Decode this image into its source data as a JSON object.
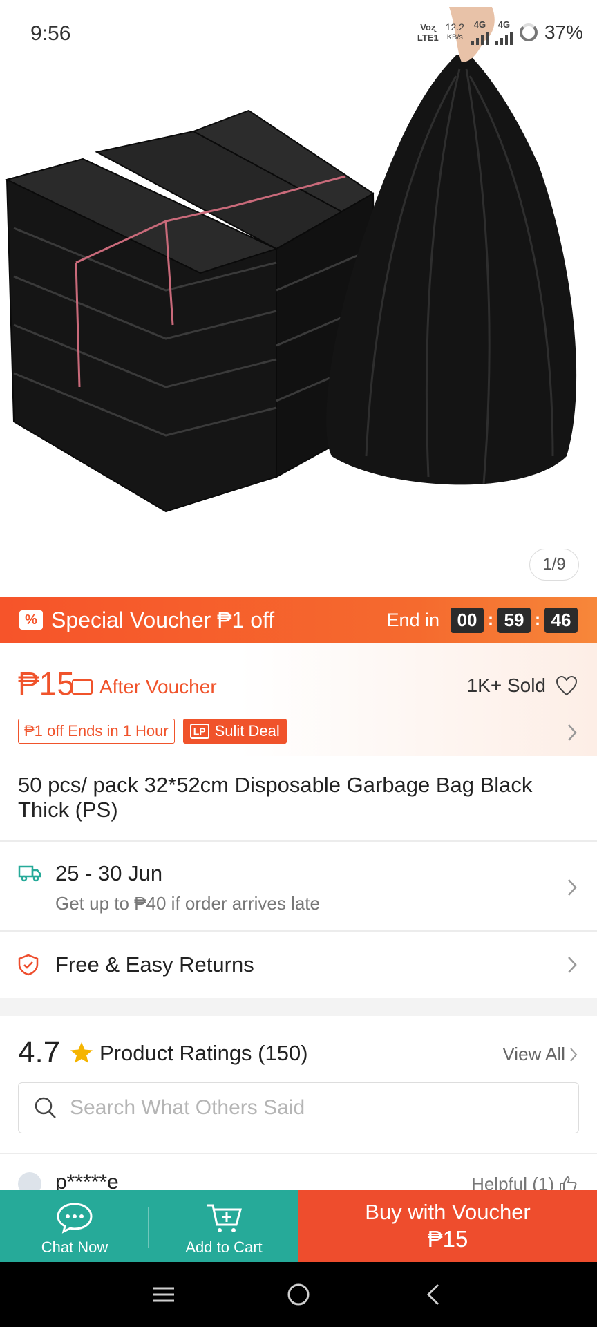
{
  "status_bar": {
    "time": "9:56",
    "volte_top": "Voʐ",
    "volte_bottom": "LTE1",
    "net_speed": "12.2",
    "net_unit": "KB/s",
    "sim1": "4G",
    "sim2": "4G",
    "battery": "37%"
  },
  "gallery": {
    "counter": "1/9",
    "image_icon": "garbage-bag-product-photo"
  },
  "voucher_bar": {
    "icon": "percent-voucher-icon",
    "label": "Special Voucher ₱1 off",
    "end_label": "End in",
    "hours": "00",
    "minutes": "59",
    "seconds": "46"
  },
  "price_section": {
    "price": "₱15",
    "after_voucher": "After Voucher",
    "sold": "1K+ Sold",
    "badge_discount": "₱1 off Ends in 1 Hour",
    "badge_deal_icon": "LP",
    "badge_deal": "Sulit Deal"
  },
  "product": {
    "title": "50 pcs/ pack 32*52cm Disposable Garbage Bag Black Thick (PS)"
  },
  "delivery": {
    "dates": "25 - 30 Jun",
    "note": "Get up to ₱40 if order arrives late"
  },
  "returns": {
    "label": "Free & Easy Returns"
  },
  "ratings": {
    "score": "4.7",
    "label": "Product Ratings (150)",
    "view_all": "View All",
    "search_placeholder": "Search What Others Said",
    "first_reviewer": "p*****e",
    "helpful": "Helpful (1)"
  },
  "action_bar": {
    "chat_label": "Chat Now",
    "cart_label": "Add to Cart",
    "buy_line1": "Buy with Voucher",
    "buy_line2": "₱15"
  },
  "colors": {
    "accent": "#ee4d2d",
    "teal": "#26aa99",
    "price": "#f0532b"
  }
}
